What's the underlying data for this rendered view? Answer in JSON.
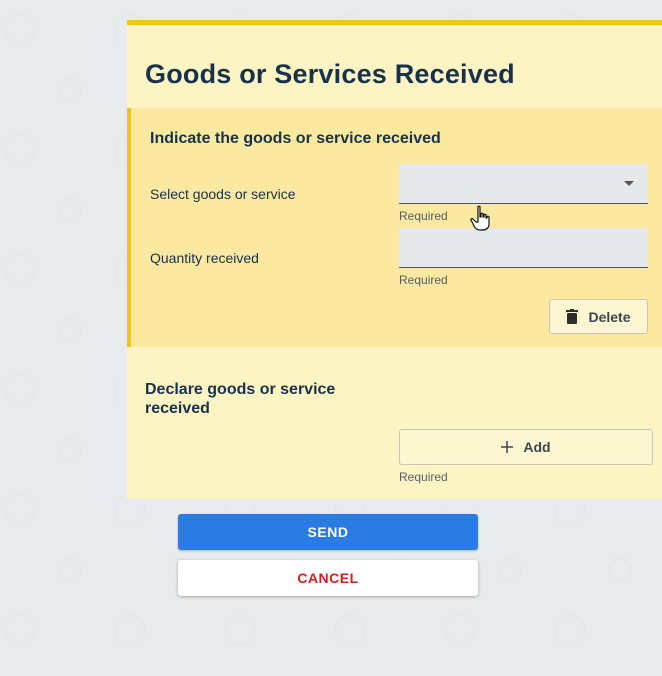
{
  "form": {
    "title": "Goods or Services Received",
    "goods_section": {
      "heading": "Indicate the goods or service received",
      "select_label": "Select goods or service",
      "select_value": "",
      "select_helper": "Required",
      "quantity_label": "Quantity received",
      "quantity_value": "",
      "quantity_helper": "Required",
      "delete_label": "Delete"
    },
    "declare_section": {
      "heading": "Declare goods or service received",
      "add_label": "Add",
      "add_helper": "Required"
    }
  },
  "actions": {
    "send_label": "SEND",
    "cancel_label": "CANCEL"
  },
  "icons": {
    "dropdown": "chevron-down-icon",
    "delete": "trash-icon",
    "add": "plus-icon",
    "cursor": "hand-pointer-icon"
  },
  "colors": {
    "accent": "#f0c419",
    "card_bg": "#fdf4c4",
    "active_section_bg": "#fbe9a1",
    "primary": "#2a7be4",
    "danger": "#d3201c",
    "heading": "#17324a"
  }
}
